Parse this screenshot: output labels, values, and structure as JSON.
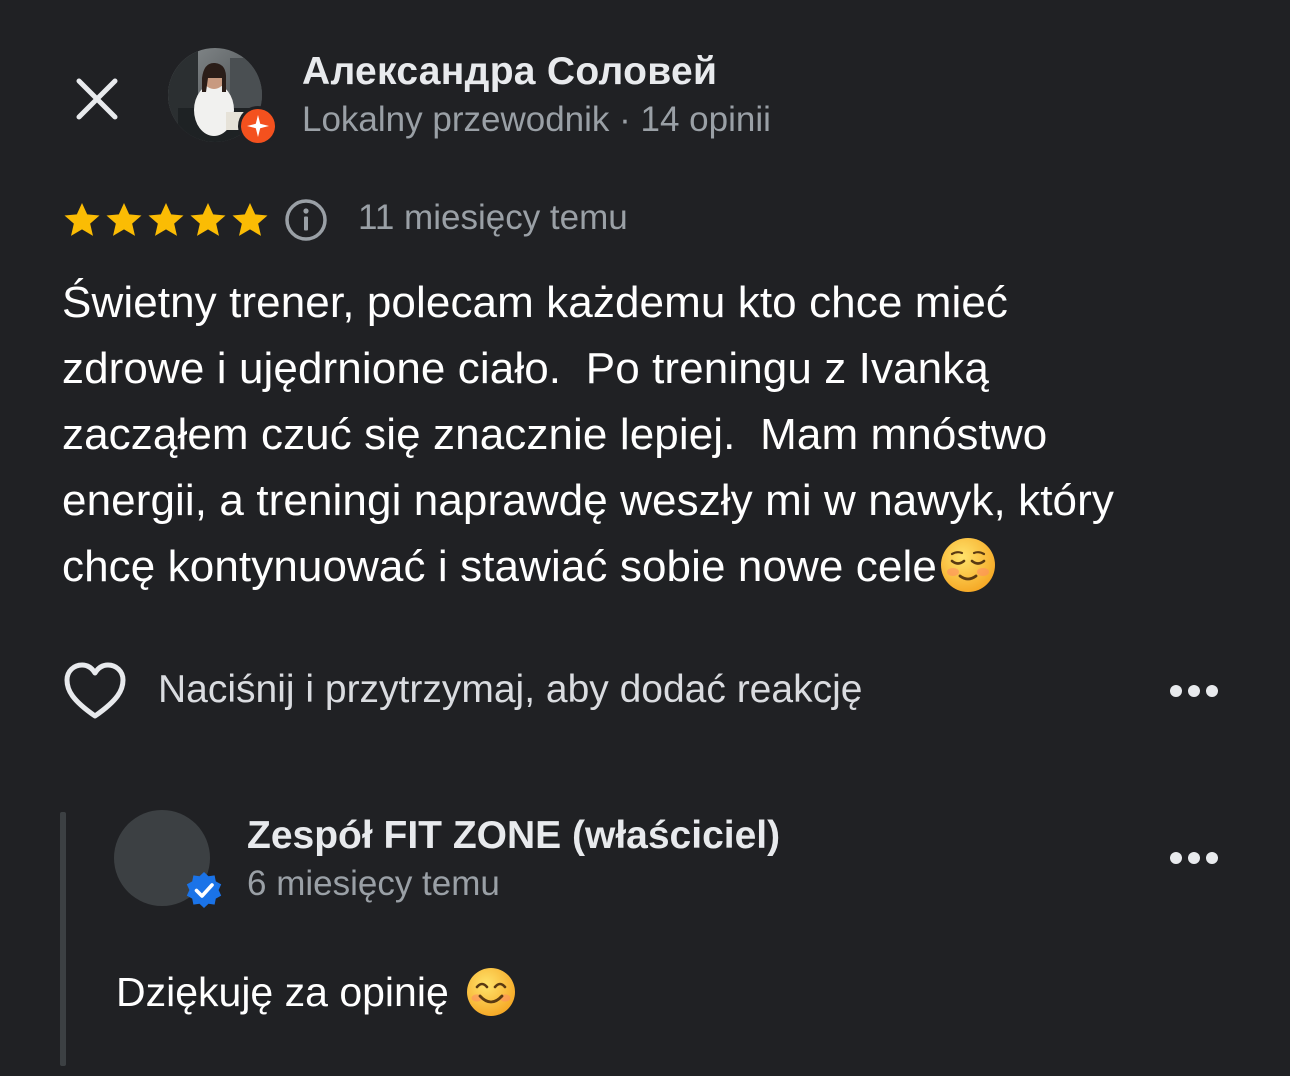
{
  "header": {
    "close_icon": "close-icon",
    "author_name": "Александра Соловей",
    "author_meta": "Lokalny przewodnik · 14 opinii",
    "local_guide_badge_icon": "local-guide-star-icon"
  },
  "rating": {
    "stars": 5,
    "max_stars": 5,
    "star_color": "#fbbc04",
    "info_icon": "info-icon",
    "time": "11 miesięcy temu"
  },
  "review": {
    "text": "Świetny trener, polecam każdemu kto chce mieć\nzdrowe i ujędrnione ciało.  Po treningu z Ivanką\nzacząłem czuć się znacznie lepiej.  Mam mnóstwo\nenergii, a treningi naprawdę weszły mi w nawyk, który\nchcę kontynuować i stawiać sobie nowe cele",
    "trailing_emoji": "☺️"
  },
  "reaction": {
    "heart_icon": "heart-outline-icon",
    "hint": "Naciśnij i przytrzymaj, aby dodać reakcję",
    "more_icon": "more-horizontal-icon"
  },
  "owner_reply": {
    "name": "Zespół FIT ZONE (właściciel)",
    "time": "6 miesięcy temu",
    "verified_icon": "verified-check-icon",
    "verified_color": "#1a73e8",
    "text": "Dziękuję za opinię",
    "trailing_emoji": "😊",
    "more_icon": "more-horizontal-icon"
  },
  "colors": {
    "background": "#202124",
    "primary_text": "#ffffff",
    "secondary_text": "#9aa0a6",
    "guide_badge": "#f4511e"
  }
}
